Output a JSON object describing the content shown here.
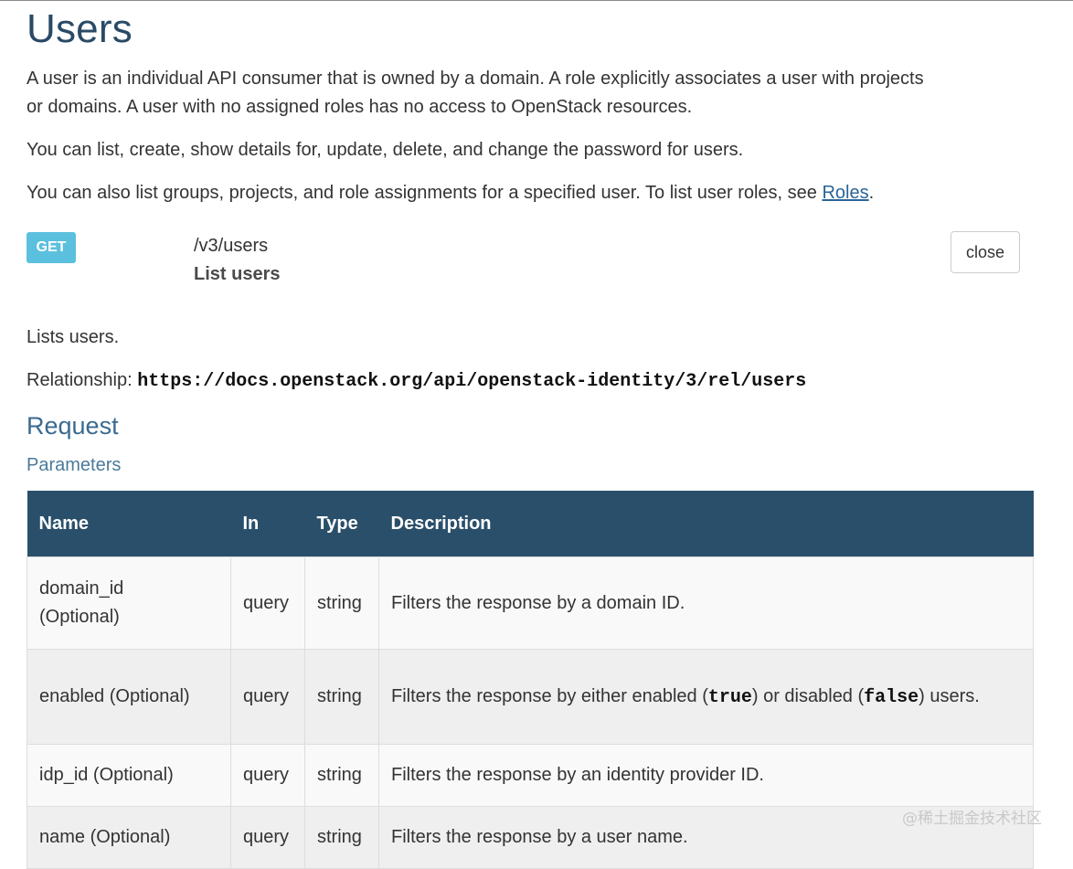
{
  "page": {
    "title": "Users",
    "intro_1": "A user is an individual API consumer that is owned by a domain. A role explicitly associates a user with projects or domains. A user with no assigned roles has no access to OpenStack resources.",
    "intro_2": "You can list, create, show details for, update, delete, and change the password for users.",
    "intro_3_prefix": "You can also list groups, projects, and role assignments for a specified user. To list user roles, see ",
    "intro_3_link": "Roles",
    "intro_3_suffix": "."
  },
  "endpoint": {
    "method": "GET",
    "path": "/v3/users",
    "name": "List users",
    "close_label": "close",
    "description": "Lists users.",
    "relationship_label": "Relationship: ",
    "relationship_url": "https://docs.openstack.org/api/openstack-identity/3/rel/users"
  },
  "request": {
    "heading": "Request",
    "subheading": "Parameters",
    "columns": [
      "Name",
      "In",
      "Type",
      "Description"
    ],
    "rows": [
      {
        "name": "domain_id",
        "optional": "(Optional)",
        "in": "query",
        "type": "string",
        "desc": "Filters the response by a domain ID."
      },
      {
        "name": "enabled (Optional)",
        "in": "query",
        "type": "string",
        "desc_a": "Filters the response by either enabled (",
        "kw1": "true",
        "desc_b": ") or disabled (",
        "kw2": "false",
        "desc_c": ") users."
      },
      {
        "name": "idp_id (Optional)",
        "in": "query",
        "type": "string",
        "desc": "Filters the response by an identity provider ID."
      },
      {
        "name": "name (Optional)",
        "in": "query",
        "type": "string",
        "desc": "Filters the response by a user name."
      }
    ]
  },
  "watermark": "@稀土掘金技术社区"
}
